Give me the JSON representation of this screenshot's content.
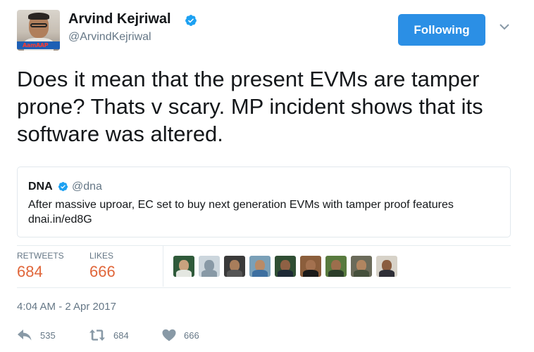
{
  "author": {
    "name": "Arvind Kejriwal",
    "handle": "@ArvindKejriwal",
    "avatar_banner_text": "AamAAP",
    "verified_icon": "verified-badge-icon"
  },
  "follow_button": {
    "label": "Following",
    "color": "#2b8fe5"
  },
  "tweet": {
    "text": "Does it mean that the present EVMs are tamper prone? Thats v scary. MP incident shows that its software was altered."
  },
  "quoted_tweet": {
    "name": "DNA",
    "handle": "@dna",
    "text_line1": "After massive uproar, EC set to buy next generation EVMs with tamper proof features",
    "text_line2": "dnai.in/ed8G"
  },
  "stats": {
    "retweets_label": "RETWEETS",
    "retweets_value": "684",
    "likes_label": "LIKES",
    "likes_value": "666",
    "value_color": "#e0663a"
  },
  "likers": [
    {
      "name": "liker-avatar-1"
    },
    {
      "name": "liker-avatar-2"
    },
    {
      "name": "liker-avatar-3"
    },
    {
      "name": "liker-avatar-4"
    },
    {
      "name": "liker-avatar-5"
    },
    {
      "name": "liker-avatar-6"
    },
    {
      "name": "liker-avatar-7"
    },
    {
      "name": "liker-avatar-8"
    },
    {
      "name": "liker-avatar-9"
    }
  ],
  "timestamp": "4:04 AM - 2 Apr 2017",
  "actions": {
    "reply_count": "535",
    "retweet_count": "684",
    "like_count": "666",
    "icons": [
      "reply-icon",
      "retweet-icon",
      "heart-icon"
    ]
  }
}
